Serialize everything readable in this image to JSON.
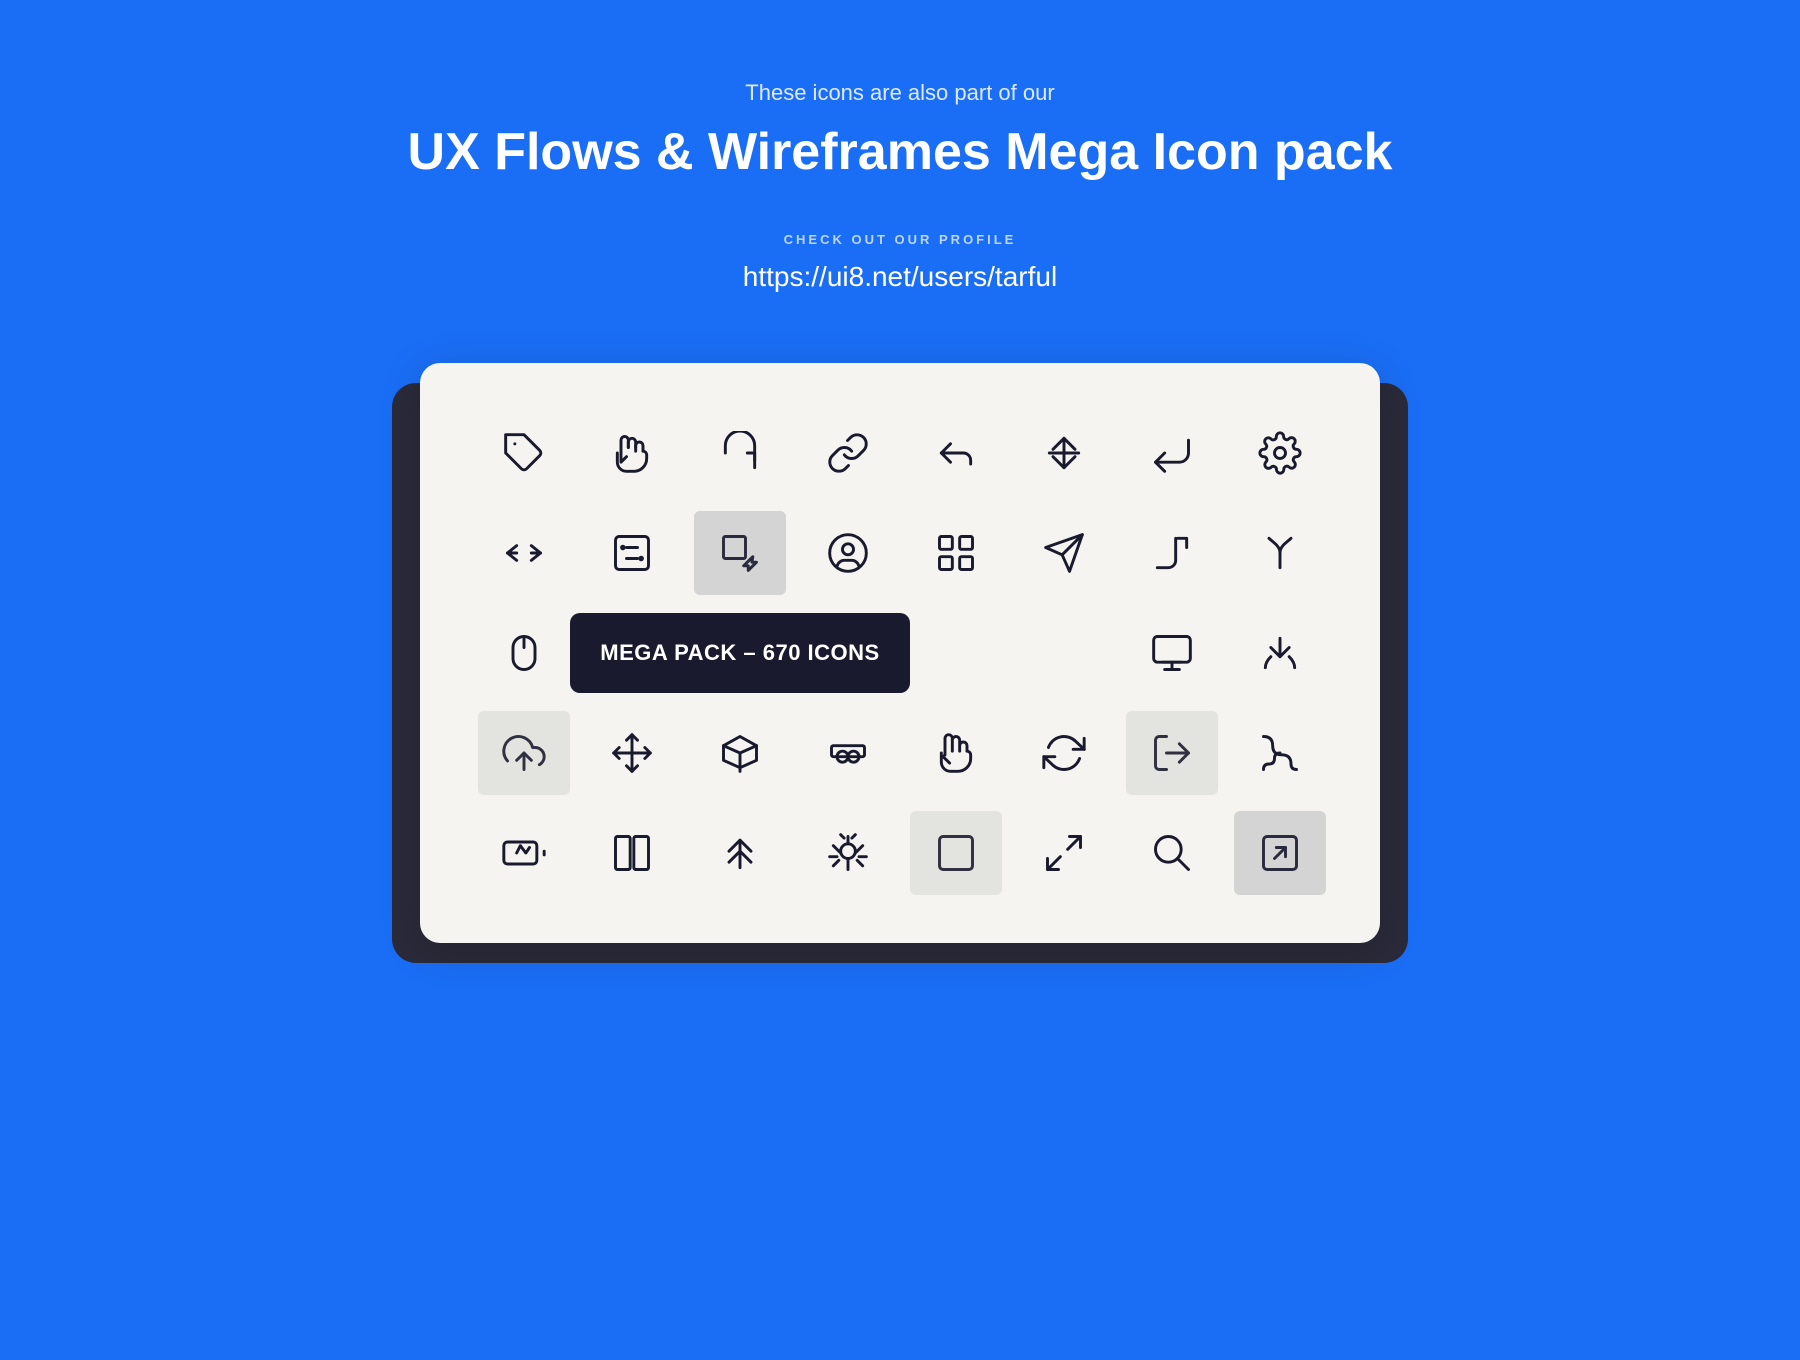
{
  "header": {
    "subtitle": "These icons are also part of our",
    "main_title": "UX Flows & Wireframes Mega Icon pack",
    "check_label": "CHECK OUT OUR PROFILE",
    "profile_url": "https://ui8.net/users/tarful"
  },
  "badge": {
    "text": "MEGA PACK – 670 ICONS"
  }
}
